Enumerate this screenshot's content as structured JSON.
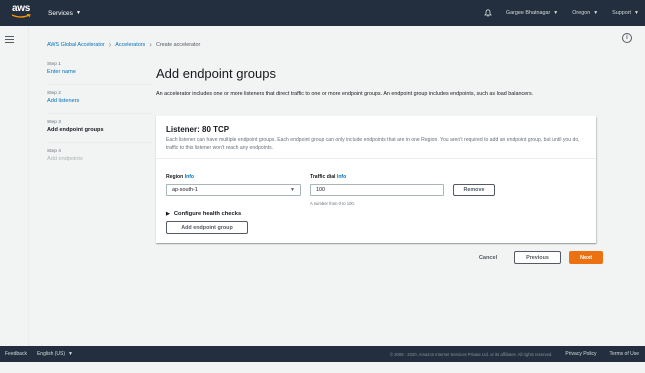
{
  "topnav": {
    "logo_text": "aws",
    "services_label": "Services",
    "user_label": "Gargee Bhatnagar",
    "region_label": "Oregon",
    "support_label": "Support",
    "bg_color": "#232f3e"
  },
  "breadcrumb": {
    "items": [
      "AWS Global Accelerator",
      "Accelerators",
      "Create accelerator"
    ]
  },
  "steps": [
    {
      "number": "Step 1",
      "label": "Enter name",
      "state": "link"
    },
    {
      "number": "Step 2",
      "label": "Add listeners",
      "state": "link"
    },
    {
      "number": "Step 3",
      "label": "Add endpoint groups",
      "state": "current"
    },
    {
      "number": "Step 4",
      "label": "Add endpoints",
      "state": "disabled"
    }
  ],
  "page": {
    "title": "Add endpoint groups",
    "description": "An accelerator includes one or more listeners that direct traffic to one or more endpoint groups. An endpoint group includes endpoints, such as load balancers."
  },
  "listener": {
    "title": "Listener: 80 TCP",
    "description": "Each listener can have multiple endpoint groups. Each endpoint group can only include endpoints that are in one Region. You aren't required to add an endpoint group, but until you do, traffic to this listener won't reach any endpoints.",
    "region_label": "Region",
    "region_info": "Info",
    "region_value": "ap-south-1",
    "traffic_label": "Traffic dial",
    "traffic_info": "Info",
    "traffic_value": "100",
    "traffic_hint": "A number from 0 to 100.",
    "remove_label": "Remove",
    "health_checks_label": "Configure health checks",
    "add_group_label": "Add endpoint group"
  },
  "actions": {
    "cancel_label": "Cancel",
    "previous_label": "Previous",
    "next_label": "Next",
    "primary_color": "#ec7211"
  },
  "footer": {
    "feedback_label": "Feedback",
    "language_label": "English (US)",
    "copyright": "© 2008 - 2020, Amazon Internet Services Private Ltd. or its affiliates. All rights reserved.",
    "privacy_label": "Privacy Policy",
    "terms_label": "Terms of Use"
  }
}
